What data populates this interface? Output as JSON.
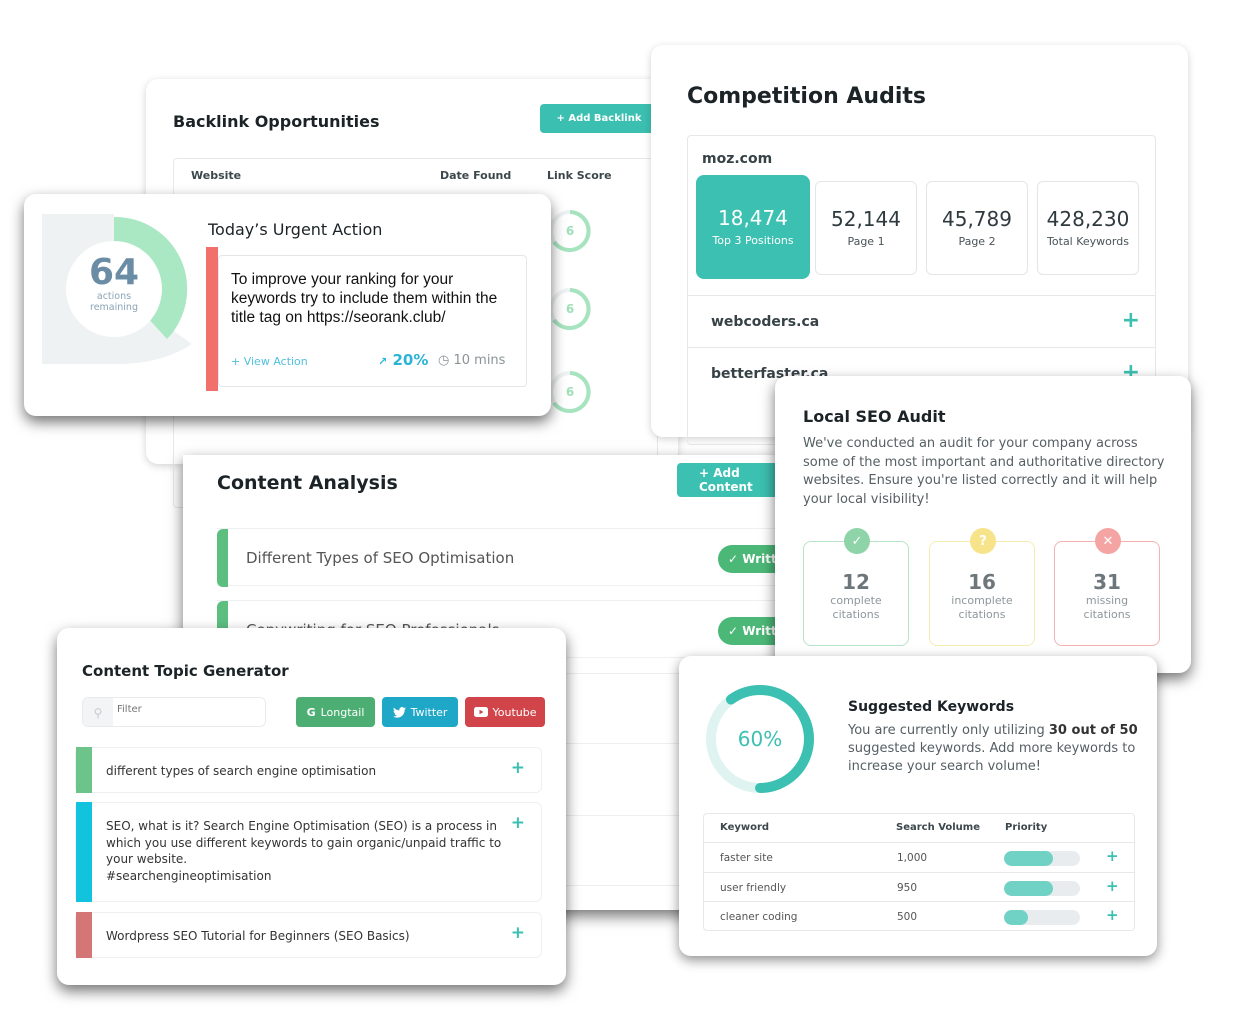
{
  "backlinks": {
    "title": "Backlink Opportunities",
    "add_button": "+ Add Backlink",
    "columns": [
      "Website",
      "Date Found",
      "Link Score"
    ],
    "scores": [
      "6",
      "6",
      "6"
    ]
  },
  "urgent": {
    "actions_remaining": "64",
    "actions_label_1": "actions",
    "actions_label_2": "remaining",
    "title": "Today’s Urgent Action",
    "message": "To improve your ranking for your keywords try to include them within the title tag on https://seorank.club/",
    "view_action": "+ View Action",
    "impact": "20%",
    "duration": "10 mins"
  },
  "competition": {
    "title": "Competition Audits",
    "primary_site": "moz.com",
    "stats": [
      {
        "value": "18,474",
        "label": "Top 3 Positions"
      },
      {
        "value": "52,144",
        "label": "Page 1"
      },
      {
        "value": "45,789",
        "label": "Page 2"
      },
      {
        "value": "428,230",
        "label": "Total Keywords"
      }
    ],
    "competitors": [
      "webcoders.ca",
      "betterfaster.ca"
    ]
  },
  "analysis": {
    "title": "Content Analysis",
    "add_button": "+ Add Content",
    "rows": [
      {
        "title": "Different Types of SEO Optimisation",
        "status": "Written"
      },
      {
        "title": "Copywriting for SEO Professionals",
        "status": "Written"
      }
    ]
  },
  "local_seo": {
    "title": "Local SEO Audit",
    "description": "We've conducted an audit for your company across some of the most important and authoritative directory websites. Ensure you're listed correctly and it will help your local visibility!",
    "citations": [
      {
        "count": "12",
        "label1": "complete",
        "label2": "citations",
        "icon": "check",
        "color": "#8fd4a9"
      },
      {
        "count": "16",
        "label1": "incomplete",
        "label2": "citations",
        "icon": "?",
        "color": "#f7e48a"
      },
      {
        "count": "31",
        "label1": "missing",
        "label2": "citations",
        "icon": "x",
        "color": "#f4a5a3"
      }
    ]
  },
  "topics": {
    "title": "Content Topic Generator",
    "filter_placeholder": "Filter",
    "buttons": [
      {
        "label": "Longtail",
        "icon": "G",
        "color": "#4cae73"
      },
      {
        "label": "Twitter",
        "icon": "twitter-bird",
        "color": "#1ea7c7"
      },
      {
        "label": "Youtube",
        "icon": "play",
        "color": "#d1454a"
      }
    ],
    "items": [
      {
        "text": "different types of search engine optimisation",
        "color": "#6cc48a"
      },
      {
        "text": "SEO, what is it? Search Engine Optimisation (SEO) is a process in which you use different keywords to gain organic/unpaid traffic to your website.",
        "hashtag": "#searchengineoptimisation",
        "color": "#12c3dd"
      },
      {
        "text": "Wordpress SEO Tutorial for Beginners (SEO Basics)",
        "color": "#d47576"
      }
    ]
  },
  "keywords": {
    "progress_label": "60%",
    "progress": 0.6,
    "title": "Suggested Keywords",
    "desc_pre": "You are currently only utilizing ",
    "desc_bold": "30 out of 50",
    "desc_post": " suggested keywords. Add more keywords to increase your search volume!",
    "columns": [
      "Keyword",
      "Search Volume",
      "Priority"
    ],
    "rows": [
      {
        "keyword": "faster site",
        "volume": "1,000",
        "priority": 0.64
      },
      {
        "keyword": "user friendly",
        "volume": "950",
        "priority": 0.64
      },
      {
        "keyword": "cleaner coding",
        "volume": "500",
        "priority": 0.32
      }
    ]
  },
  "colors": {
    "accent": "#3cc0b1",
    "green": "#5cbf80",
    "red": "#f2706b"
  }
}
